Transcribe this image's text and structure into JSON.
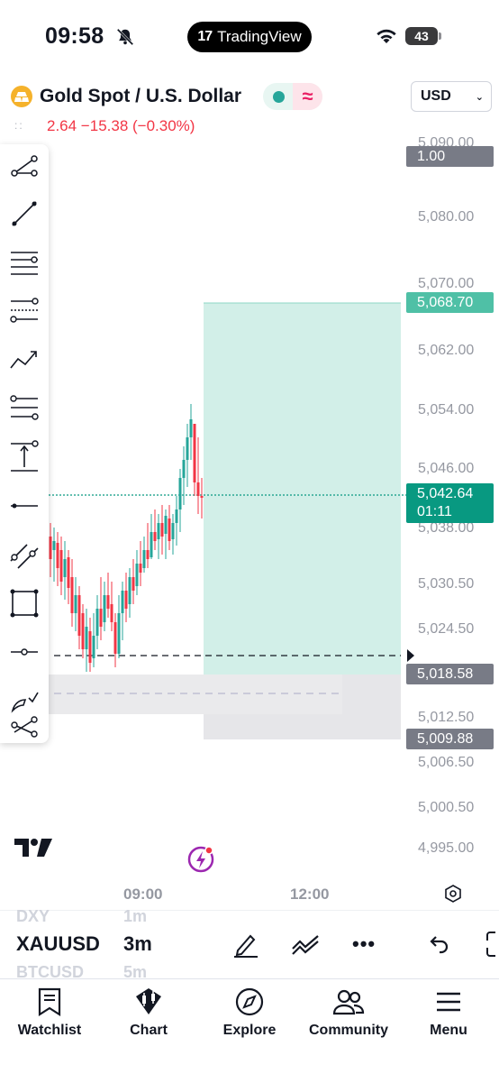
{
  "status_bar": {
    "time": "09:58",
    "app_pill": "TradingView",
    "battery": "43"
  },
  "header": {
    "symbol_title": "Gold Spot / U.S. Dollar",
    "change_text": "2.64 −15.38 (−0.30%)",
    "currency": "USD"
  },
  "price_axis": {
    "labels": [
      "5,090.00",
      "5,080.00",
      "5,070.00",
      "5,062.00",
      "5,054.00",
      "5,046.00",
      "5,038.00",
      "5,030.50",
      "5,024.50",
      "5,012.50",
      "5,006.50",
      "5,000.50",
      "4,995.00"
    ],
    "tags": {
      "scale": "1.00",
      "target": "5,068.70",
      "current_price": "5,042.64",
      "countdown": "01:11",
      "entry": "5,018.58",
      "stop": "5,009.88"
    }
  },
  "time_axis": {
    "labels": [
      "09:00",
      "12:00"
    ]
  },
  "instrument_bar": {
    "symbol": "XAUUSD",
    "symbol_above": "DXY",
    "symbol_below": "BTCUSD",
    "interval": "3m",
    "interval_above": "1m",
    "interval_below": "5m"
  },
  "tabs": [
    {
      "label": "Watchlist",
      "icon": "watchlist-icon"
    },
    {
      "label": "Chart",
      "icon": "chart-icon"
    },
    {
      "label": "Explore",
      "icon": "compass-icon"
    },
    {
      "label": "Community",
      "icon": "community-icon"
    },
    {
      "label": "Menu",
      "icon": "menu-icon"
    }
  ],
  "colors": {
    "up": "#26a69a",
    "down": "#f23645",
    "profit_zone": "#d2efe8",
    "loss_zone": "#e6e6e9",
    "accent": "#089981"
  }
}
